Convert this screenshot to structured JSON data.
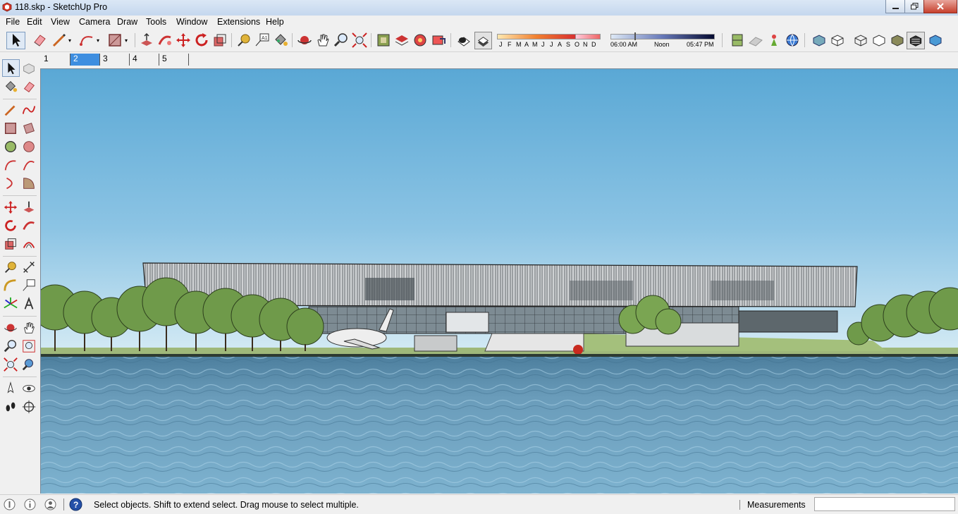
{
  "window": {
    "title": "118.skp - SketchUp Pro",
    "controls": [
      "minimize-icon",
      "restore-icon",
      "close-icon"
    ]
  },
  "menu": {
    "items": [
      "File",
      "Edit",
      "View",
      "Camera",
      "Draw",
      "Tools",
      "Window",
      "Extensions",
      "Help"
    ]
  },
  "toolbar": {
    "months": [
      "J",
      "F",
      "M",
      "A",
      "M",
      "J",
      "J",
      "A",
      "S",
      "O",
      "N",
      "D"
    ],
    "time_start": "06:00 AM",
    "time_mid": "Noon",
    "time_end": "05:47 PM"
  },
  "scenes": {
    "tabs": [
      "1",
      "2",
      "3",
      "4",
      "5"
    ],
    "active": "2"
  },
  "status": {
    "message": "Select objects. Shift to extend select. Drag mouse to select multiple.",
    "measurements_label": "Measurements",
    "measurements_value": ""
  },
  "colors": {
    "sky_top": "#5aa9d6",
    "sky_bottom": "#cfe8f5",
    "water": "#5e93b4",
    "accent_tab": "#3e8ee0"
  }
}
